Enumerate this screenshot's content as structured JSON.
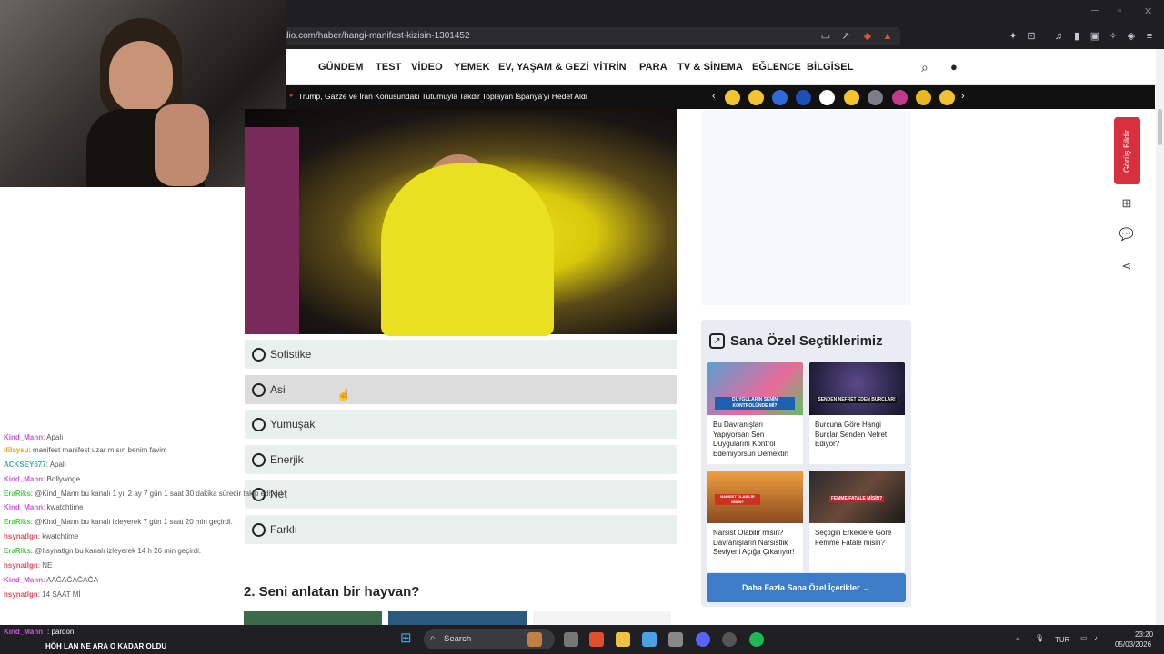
{
  "browser": {
    "url": "dio.com/haber/hangi-manifest-kizisin-1301452"
  },
  "site": {
    "nav": [
      "GÜNDEM",
      "TEST",
      "VİDEO",
      "YEMEK",
      "EV, YAŞAM & GEZİ",
      "VİTRİN",
      "PARA",
      "TV & SİNEMA",
      "EĞLENCE",
      "BİLGİSEL"
    ],
    "ticker": "Trump, Gazze ve İran Konusundaki Tutumuyla Takdir Toplayan İspanya'yı Hedef Aldı",
    "emoji_colors": [
      "#f4c430",
      "#f4c430",
      "#2e6ad8",
      "#1d4fb8",
      "#ffffff",
      "#f4c430",
      "#7d7d8a",
      "#c13a8c",
      "#e8b820",
      "#f0c030"
    ]
  },
  "quiz": {
    "options": [
      "Sofistike",
      "Asi",
      "Yumuşak",
      "Enerjik",
      "Net",
      "Farklı"
    ],
    "next_question": "2. Seni anlatan bir hayvan?"
  },
  "sidebar": {
    "title": "Sana Özel Seçtiklerimiz",
    "cards": [
      {
        "text": "Bu Davranışları Yapıyorsan Sen Duygularını Kontrol Edemiyorsun Demektir!",
        "thumb_caption": "DUYGULARIN SENİN KONTROLÜNDE Mİ?"
      },
      {
        "text": "Burcuna Göre Hangi Burçlar Senden Nefret Ediyor?",
        "thumb_caption": "SENDEN NEFRET EDEN BURÇLAR!"
      },
      {
        "text": "Narsist Olabilir misin? Davranışların Narsistlik Seviyeni Açığa Çıkarıyor!",
        "thumb_caption": "NARSİST OLABİLİR MİSİN?"
      },
      {
        "text": "Seçtiğin Erkeklere Göre Femme Fatale misin?",
        "thumb_caption": "FEMME FATALE MİSİN?"
      }
    ],
    "more_button": "Daha Fazla Sana Özel İçerikler  →"
  },
  "rail": {
    "feedback": "Görüş Bildir"
  },
  "chat": [
    {
      "user": "Kind_Mann",
      "color": "#c85ad8",
      "msg": ": Apalı"
    },
    {
      "user": "dilaysu",
      "color": "#e0a020",
      "msg": ": manifest manifest uzar mısın benim favim"
    },
    {
      "user": "ACKSEY677",
      "color": "#3ab0a0",
      "msg": ": Apalı"
    },
    {
      "user": "Kind_Mann",
      "color": "#c85ad8",
      "msg": ": Bollywoge"
    },
    {
      "user": "EraRiks",
      "color": "#44cc44",
      "msg": ": @Kind_Mann bu kanalı 1 yıl 2 ay 7 gün 1 saat 30 dakika süredir takip ediyor!"
    },
    {
      "user": "Kind_Mann",
      "color": "#c85ad8",
      "msg": ": kwatchtime"
    },
    {
      "user": "EraRiks",
      "color": "#44cc44",
      "msg": ": @Kind_Mann bu kanalı izleyerek 7 gün 1 saat 20 min geçirdi."
    },
    {
      "user": "hsynatlgn",
      "color": "#e05060",
      "msg": ": kwatchtime"
    },
    {
      "user": "EraRiks",
      "color": "#44cc44",
      "msg": ": @hsynatlgn bu kanalı izleyerek 14 h 26 min geçirdi."
    },
    {
      "user": "hsynatlgn",
      "color": "#e05060",
      "msg": ": NE"
    },
    {
      "user": "Kind_Mann",
      "color": "#c85ad8",
      "msg": ": AAĞAĞAĞAĞA"
    },
    {
      "user": "hsynatlgn",
      "color": "#e05060",
      "msg": ": 14 SAAT Mİ"
    },
    {
      "user": "Kind_Mann",
      "color": "#c85ad8",
      "msg": ": pardon"
    }
  ],
  "overlay_text": "HÖH LAN NE ARA O KADAR OLDU",
  "taskbar": {
    "search_label": "Search",
    "lang": "TUR",
    "time": "23:20",
    "date": "05/03/2026"
  }
}
